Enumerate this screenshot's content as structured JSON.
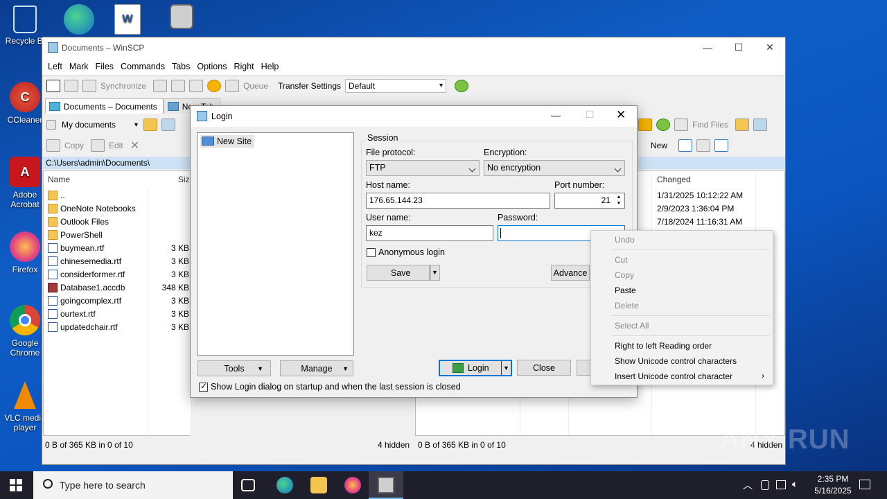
{
  "desktop": {
    "icons": [
      {
        "label": "Recycle Bin",
        "display": "Recycle Bi"
      },
      {
        "label": "CCleaner",
        "display": "CCleaner"
      },
      {
        "label": "Adobe Acrobat",
        "display": "Adobe Acrobat"
      },
      {
        "label": "Firefox",
        "display": "Firefox"
      },
      {
        "label": "Google Chrome",
        "display": "Google Chrome"
      },
      {
        "label": "VLC media player",
        "display": "VLC media player"
      }
    ]
  },
  "winscp": {
    "title": "Documents – WinSCP",
    "menu": [
      "Left",
      "Mark",
      "Files",
      "Commands",
      "Tabs",
      "Options",
      "Right",
      "Help"
    ],
    "toolbar": {
      "synchronize": "Synchronize",
      "queue": "Queue",
      "transfer_settings_label": "Transfer Settings",
      "transfer_settings_value": "Default"
    },
    "tabs": [
      "Documents – Documents",
      "New Tab"
    ],
    "left_panel": {
      "location": "My documents",
      "copy": "Copy",
      "edit": "Edit",
      "path": "C:\\Users\\admin\\Documents\\",
      "col_name": "Name",
      "col_size": "Size",
      "files": [
        {
          "name": "..",
          "size": "",
          "type": "up"
        },
        {
          "name": "OneNote Notebooks",
          "size": "",
          "type": "folder"
        },
        {
          "name": "Outlook Files",
          "size": "",
          "type": "folder"
        },
        {
          "name": "PowerShell",
          "size": "",
          "type": "folder"
        },
        {
          "name": "buymean.rtf",
          "size": "3 KB",
          "type": "rtf"
        },
        {
          "name": "chinesemedia.rtf",
          "size": "3 KB",
          "type": "rtf"
        },
        {
          "name": "considerformer.rtf",
          "size": "3 KB",
          "type": "rtf"
        },
        {
          "name": "Database1.accdb",
          "size": "348 KB",
          "type": "db"
        },
        {
          "name": "goingcomplex.rtf",
          "size": "3 KB",
          "type": "rtf"
        },
        {
          "name": "ourtext.rtf",
          "size": "3 KB",
          "type": "rtf"
        },
        {
          "name": "updatedchair.rtf",
          "size": "3 KB",
          "type": "rtf"
        }
      ],
      "status": "0 B of 365 KB in 0 of 10",
      "hidden": "4 hidden"
    },
    "right_panel": {
      "find_files": "Find Files",
      "new": "New",
      "col_changed": "Changed",
      "changed": [
        "1/31/2025 10:12:22 AM",
        "2/9/2023 1:36:04 PM",
        "7/18/2024 11:16:31 AM"
      ],
      "status": "0 B of 365 KB in 0 of 10",
      "hidden": "4 hidden"
    }
  },
  "login": {
    "title": "Login",
    "site_tree": [
      "New Site"
    ],
    "session_label": "Session",
    "file_protocol_label": "File protocol:",
    "file_protocol_value": "FTP",
    "encryption_label": "Encryption:",
    "encryption_value": "No encryption",
    "host_label": "Host name:",
    "host_value": "176.65.144.23",
    "port_label": "Port number:",
    "port_value": "21",
    "user_label": "User name:",
    "user_value": "kez",
    "password_label": "Password:",
    "password_value": "",
    "anonymous_label": "Anonymous login",
    "save": "Save",
    "advanced": "Advance",
    "tools": "Tools",
    "manage": "Manage",
    "login_btn": "Login",
    "close_btn": "Close",
    "show_login_label": "Show Login dialog on startup and when the last session is closed"
  },
  "context_menu": {
    "items": [
      {
        "label": "Undo",
        "enabled": false
      },
      {
        "label": "Cut",
        "enabled": false
      },
      {
        "label": "Copy",
        "enabled": false
      },
      {
        "label": "Paste",
        "enabled": true
      },
      {
        "label": "Delete",
        "enabled": false
      },
      {
        "label": "Select All",
        "enabled": false
      },
      {
        "label": "Right to left Reading order",
        "enabled": true
      },
      {
        "label": "Show Unicode control characters",
        "enabled": true
      },
      {
        "label": "Insert Unicode control character",
        "enabled": true
      }
    ]
  },
  "taskbar": {
    "search_placeholder": "Type here to search",
    "time": "2:35 PM",
    "date": "5/16/2025"
  },
  "watermark": "ANY RUN",
  "colors": {
    "desktop": "#0f5ec7",
    "accent": "#0078d7",
    "path_bar": "#cde3f5",
    "taskbar": "#1f1f2b"
  }
}
